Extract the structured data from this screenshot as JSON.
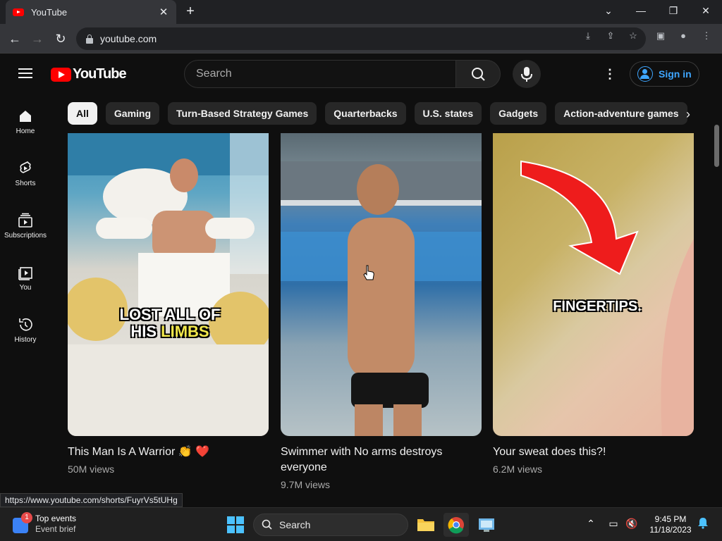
{
  "browser": {
    "tab_title": "YouTube",
    "tab_close": "✕",
    "new_tab": "+",
    "url": "youtube.com",
    "status_url": "https://www.youtube.com/shorts/FuyrVs5tUHg"
  },
  "yt": {
    "logo_text": "YouTube",
    "search_placeholder": "Search",
    "sign_in": "Sign in"
  },
  "sidebar": {
    "items": [
      {
        "label": "Home"
      },
      {
        "label": "Shorts"
      },
      {
        "label": "Subscriptions"
      },
      {
        "label": "You"
      },
      {
        "label": "History"
      }
    ]
  },
  "chips": [
    "All",
    "Gaming",
    "Turn-Based Strategy Games",
    "Quarterbacks",
    "U.S. states",
    "Gadgets",
    "Action-adventure games"
  ],
  "shorts": [
    {
      "title": "This Man Is A Warrior 👏 ❤️",
      "views": "50M views",
      "overlay_line1": "LOST ALL OF",
      "overlay_line2a": "HIS ",
      "overlay_line2b": "LIMBS"
    },
    {
      "title": "Swimmer with No arms destroys everyone",
      "views": "9.7M views"
    },
    {
      "title": "Your sweat does this?!",
      "views": "6.2M views",
      "overlay": "FINGERTIPS."
    }
  ],
  "taskbar": {
    "widget_badge": "1",
    "widget_title": "Top events",
    "widget_sub": "Event brief",
    "search_label": "Search",
    "time": "9:45 PM",
    "date": "11/18/2023"
  },
  "colors": {
    "accent_red": "#ff0000",
    "link_blue": "#3ea6ff",
    "background": "#0f0f0f"
  }
}
